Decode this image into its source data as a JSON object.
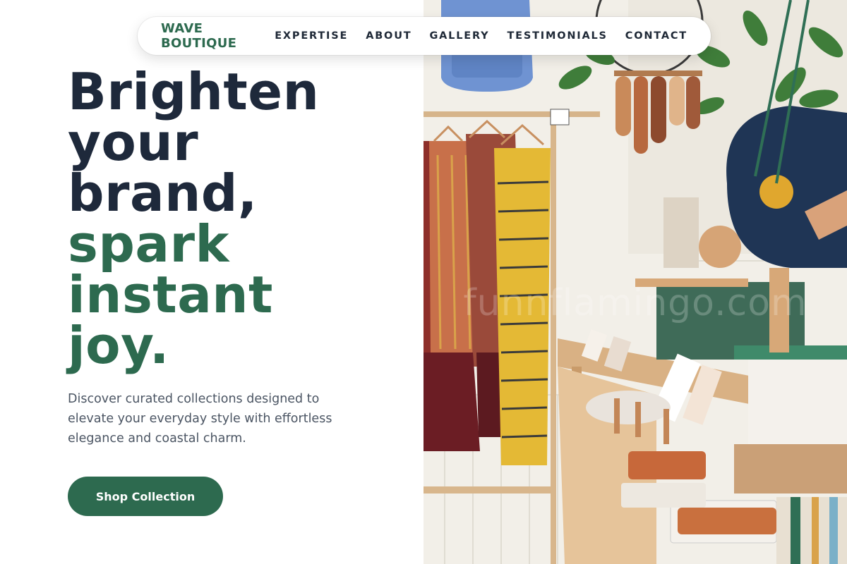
{
  "nav": {
    "brand": "WAVE BOUTIQUE",
    "links": [
      "EXPERTISE",
      "ABOUT",
      "GALLERY",
      "TESTIMONIALS",
      "CONTACT"
    ]
  },
  "hero": {
    "title_lines": [
      "Brighten",
      "your",
      "brand,"
    ],
    "accent_lines": [
      "spark",
      "instant",
      "joy."
    ],
    "subtitle": "Discover curated collections designed to elevate your everyday style with effortless elegance and coastal charm.",
    "cta_label": "Shop Collection"
  },
  "image": {
    "alt": "Boutique interior with clothing rack, plants and accessories",
    "watermark": "funnflamingo.com"
  },
  "colors": {
    "accent": "#2d6a4f",
    "heading": "#1e293b",
    "body_text": "#4b5563"
  }
}
